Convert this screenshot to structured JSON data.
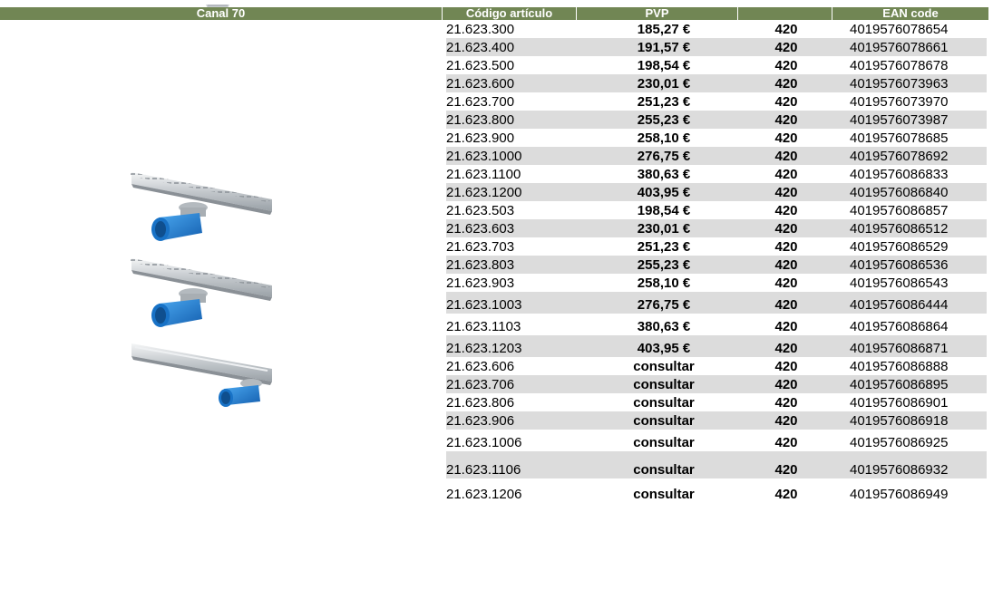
{
  "header": {
    "product": "Canal 70",
    "code": "Código artículo",
    "price": "PVP",
    "units": "",
    "ean": "EAN code"
  },
  "rows": [
    {
      "code": "21.623.300",
      "price": "185,27 €",
      "units": "420",
      "ean": "4019576078654"
    },
    {
      "code": "21.623.400",
      "price": "191,57 €",
      "units": "420",
      "ean": "4019576078661"
    },
    {
      "code": "21.623.500",
      "price": "198,54 €",
      "units": "420",
      "ean": "4019576078678"
    },
    {
      "code": "21.623.600",
      "price": "230,01 €",
      "units": "420",
      "ean": "4019576073963"
    },
    {
      "code": "21.623.700",
      "price": "251,23 €",
      "units": "420",
      "ean": "4019576073970"
    },
    {
      "code": "21.623.800",
      "price": "255,23 €",
      "units": "420",
      "ean": "4019576073987"
    },
    {
      "code": "21.623.900",
      "price": "258,10 €",
      "units": "420",
      "ean": "4019576078685"
    },
    {
      "code": "21.623.1000",
      "price": "276,75 €",
      "units": "420",
      "ean": "4019576078692"
    },
    {
      "code": "21.623.1100",
      "price": "380,63 €",
      "units": "420",
      "ean": "4019576086833"
    },
    {
      "code": "21.623.1200",
      "price": "403,95 €",
      "units": "420",
      "ean": "4019576086840"
    },
    {
      "code": "21.623.503",
      "price": "198,54 €",
      "units": "420",
      "ean": "4019576086857"
    },
    {
      "code": "21.623.603",
      "price": "230,01 €",
      "units": "420",
      "ean": "4019576086512"
    },
    {
      "code": "21.623.703",
      "price": "251,23 €",
      "units": "420",
      "ean": "4019576086529"
    },
    {
      "code": "21.623.803",
      "price": "255,23 €",
      "units": "420",
      "ean": "4019576086536"
    },
    {
      "code": "21.623.903",
      "price": "258,10 €",
      "units": "420",
      "ean": "4019576086543"
    },
    {
      "code": "21.623.1003",
      "price": "276,75 €",
      "units": "420",
      "ean": "4019576086444"
    },
    {
      "code": "21.623.1103",
      "price": "380,63 €",
      "units": "420",
      "ean": "4019576086864"
    },
    {
      "code": "21.623.1203",
      "price": "403,95 €",
      "units": "420",
      "ean": "4019576086871"
    },
    {
      "code": "21.623.606",
      "price": "consultar",
      "units": "420",
      "ean": "4019576086888"
    },
    {
      "code": "21.623.706",
      "price": "consultar",
      "units": "420",
      "ean": "4019576086895"
    },
    {
      "code": "21.623.806",
      "price": "consultar",
      "units": "420",
      "ean": "4019576086901"
    },
    {
      "code": "21.623.906",
      "price": "consultar",
      "units": "420",
      "ean": "4019576086918"
    },
    {
      "code": "21.623.1006",
      "price": "consultar",
      "units": "420",
      "ean": "4019576086925"
    },
    {
      "code": "21.623.1106",
      "price": "consultar",
      "units": "420",
      "ean": "4019576086932"
    },
    {
      "code": "21.623.1206",
      "price": "consultar",
      "units": "420",
      "ean": "4019576086949"
    }
  ],
  "colors": {
    "header_bg": "#718654",
    "stripe": "#dcdcdc",
    "drain_blue": "#1f86d6"
  }
}
